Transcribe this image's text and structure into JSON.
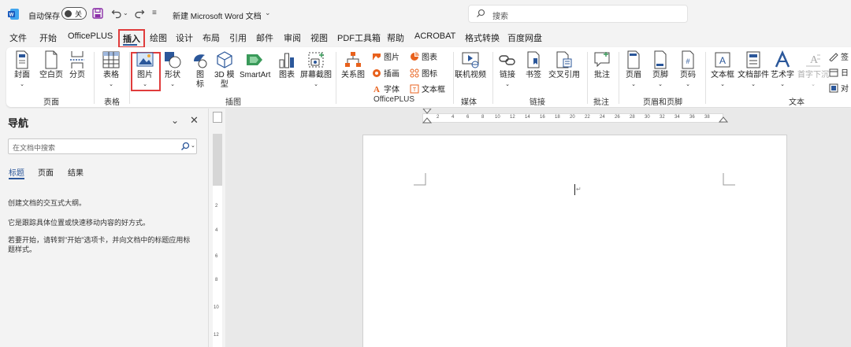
{
  "titlebar": {
    "autosave_label": "自动保存",
    "autosave_state": "关",
    "doc_title": "新建 Microsoft Word 文档",
    "search_placeholder": "搜索"
  },
  "tabs": [
    "文件",
    "开始",
    "OfficePLUS",
    "插入",
    "绘图",
    "设计",
    "布局",
    "引用",
    "邮件",
    "审阅",
    "视图",
    "PDF工具箱",
    "帮助",
    "ACROBAT",
    "格式转换",
    "百度网盘"
  ],
  "active_tab": "插入",
  "accent_color": "#2b579a",
  "highlight_color": "#e03c3c",
  "ribbon": {
    "cover": "封面",
    "blank": "空白页",
    "pagebreak": "分页",
    "table": "表格",
    "picture": "图片",
    "shapes": "形状",
    "icons_l1": "图",
    "icons_l2": "标",
    "model3d_l1": "3D 模",
    "model3d_l2": "型",
    "smartart": "SmartArt",
    "chart": "图表",
    "screenshot": "屏幕截图",
    "relation": "关系图",
    "op_picture": "图片",
    "op_illus": "插画",
    "op_font": "字体",
    "op_chart": "图表",
    "op_icon": "图标",
    "op_textbox": "文本框",
    "online_video": "联机视频",
    "link": "链接",
    "bookmark": "书签",
    "crossref": "交叉引用",
    "comment": "批注",
    "header": "页眉",
    "footer": "页脚",
    "pagenum": "页码",
    "textbox": "文本框",
    "docparts": "文档部件",
    "wordart": "艺术字",
    "dropcap": "首字下沉",
    "sig": "签",
    "date": "日",
    "obj": "对"
  },
  "groups": {
    "pages": "页面",
    "tables": "表格",
    "illustrations": "插图",
    "officeplus": "OfficePLUS",
    "media": "媒体",
    "links": "链接",
    "comments": "批注",
    "header_footer": "页眉和页脚",
    "text": "文本"
  },
  "nav": {
    "title": "导航",
    "search_placeholder": "在文档中搜索",
    "tabs": [
      "标题",
      "页面",
      "结果"
    ],
    "line1": "创建文档的交互式大纲。",
    "line2": "它是跟踪具体位置或快速移动内容的好方式。",
    "line3a": "若要开始，请转到\"开始\"选项卡，并向文档中的标题应用标",
    "line3b": "题样式。"
  },
  "ruler_h": [
    "2",
    "4",
    "6",
    "8",
    "10",
    "12",
    "14",
    "16",
    "18",
    "20",
    "22",
    "24",
    "26",
    "28",
    "30",
    "32",
    "34",
    "36",
    "38"
  ],
  "ruler_v": [
    "2",
    "4",
    "6",
    "8",
    "10",
    "12"
  ]
}
